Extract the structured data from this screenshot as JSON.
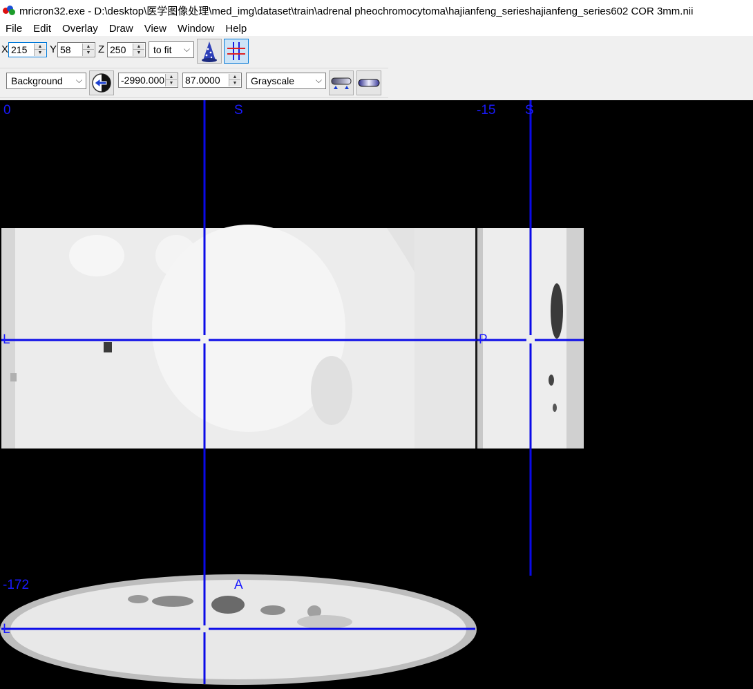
{
  "window": {
    "title": "mricron32.exe - D:\\desktop\\医学图像处理\\med_img\\dataset\\train\\adrenal pheochromocytoma\\hajianfeng_serieshajianfeng_series602 COR 3mm.nii"
  },
  "menu": {
    "file": "File",
    "edit": "Edit",
    "overlay": "Overlay",
    "draw": "Draw",
    "view": "View",
    "window": "Window",
    "help": "Help"
  },
  "coords": {
    "x_label": "X",
    "x_value": "215",
    "y_label": "Y",
    "y_value": "58",
    "z_label": "Z",
    "z_value": "250",
    "zoom_selected": "to fit"
  },
  "layer": {
    "selected": "Background",
    "min_value": "-2990.000",
    "max_value": "87.0000",
    "colormap_selected": "Grayscale"
  },
  "icons": {
    "app": "mricron-brain-icon",
    "render": "wizard-hat-icon",
    "crosshair": "crosshair-grid-icon",
    "swap": "swap-arrow-icon",
    "colorbar_a": "colorbar-horizontal-icon",
    "colorbar_b": "colorbar-pill-icon"
  },
  "colors": {
    "crosshair": "#0a0ae8",
    "label": "#1a1aff",
    "active_button": "#0078d7"
  },
  "views": {
    "coronal": {
      "slice_label": "0",
      "top_label": "S",
      "left_label": "L"
    },
    "sagittal": {
      "slice_label": "-15",
      "top_label": "S",
      "left_label": "P"
    },
    "axial": {
      "slice_label": "-172",
      "top_label": "A",
      "left_label": "L"
    }
  }
}
